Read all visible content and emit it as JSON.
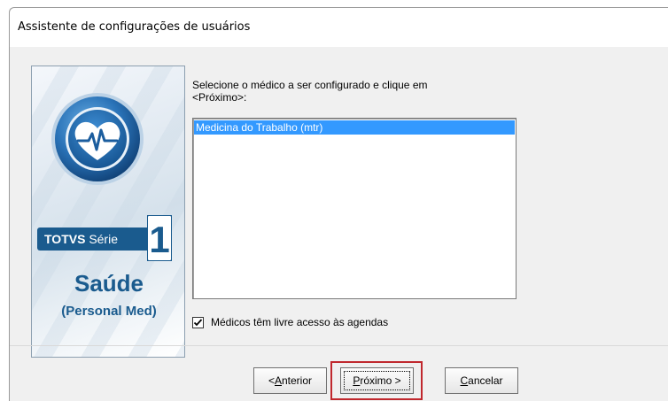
{
  "window": {
    "title": "Assistente de configurações de usuários"
  },
  "logo": {
    "brand": "TOTVS",
    "serie": "Série",
    "serie_number": "1",
    "product": "Saúde",
    "product_sub": "(Personal Med)",
    "icon": "heart-pulse-icon"
  },
  "instructions": {
    "line1": "Selecione o médico a ser configurado e clique em",
    "line2": "<Próximo>:"
  },
  "doctor_list": {
    "items": [
      "Medicina do Trabalho (mtr)"
    ],
    "selected_index": 0
  },
  "options": {
    "free_access_label": "Médicos têm livre acesso às agendas",
    "free_access_checked": true
  },
  "buttons": {
    "prev_prefix": "< ",
    "prev_mnemonic": "A",
    "prev_rest": "nterior",
    "next_mnemonic": "P",
    "next_rest": "róximo >",
    "cancel_mnemonic": "C",
    "cancel_rest": "ancelar"
  },
  "colors": {
    "selection": "#3399ff",
    "brand_blue": "#1a5b8e",
    "highlight": "#c0282e"
  }
}
